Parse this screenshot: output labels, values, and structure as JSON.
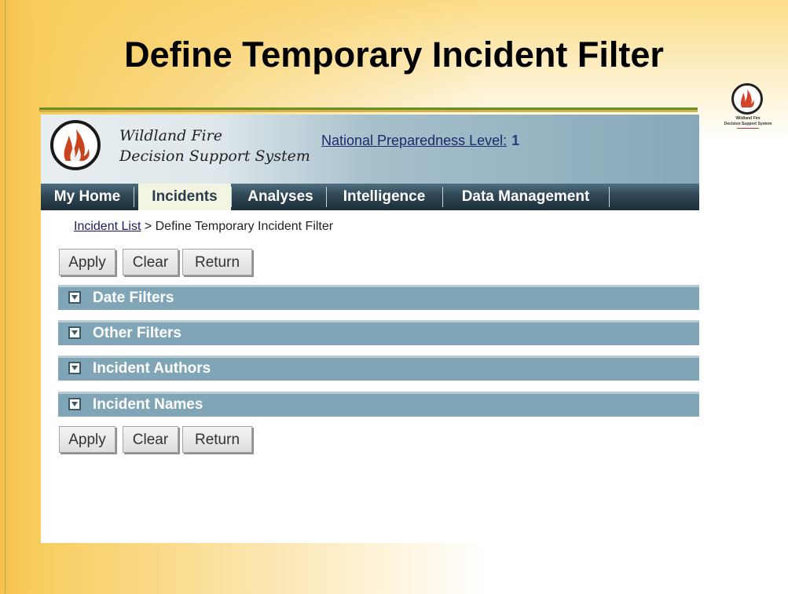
{
  "slide": {
    "title": "Define Temporary Incident Filter",
    "corner_logo": {
      "line1": "Wildland Fire",
      "line2": "Decision Support System",
      "icon": "flame-logo-icon"
    }
  },
  "app": {
    "name_line1": "Wildland Fire",
    "name_line2": "Decision Support System",
    "logo_icon": "flame-logo-icon",
    "preparedness_label": "National Preparedness Level:",
    "preparedness_value": "1"
  },
  "nav": {
    "items": [
      {
        "label": "My Home",
        "active": false
      },
      {
        "label": "Incidents",
        "active": true
      },
      {
        "label": "Analyses",
        "active": false
      },
      {
        "label": "Intelligence",
        "active": false
      },
      {
        "label": "Data Management",
        "active": false
      }
    ]
  },
  "breadcrumb": {
    "link": "Incident List",
    "separator": " > ",
    "current": "Define Temporary Incident Filter"
  },
  "buttons": {
    "apply": "Apply",
    "clear": "Clear",
    "return": "Return"
  },
  "sections": [
    {
      "label": "Date Filters",
      "icon": "collapse-toggle-icon"
    },
    {
      "label": "Other Filters",
      "icon": "collapse-toggle-icon"
    },
    {
      "label": "Incident Authors",
      "icon": "collapse-toggle-icon"
    },
    {
      "label": "Incident Names",
      "icon": "collapse-toggle-icon"
    }
  ],
  "colors": {
    "section_bar": "#7fa5b7",
    "nav_dark": "#2f4654",
    "active_tab": "#f2f5e1",
    "title_rule": "#6b8e23"
  }
}
